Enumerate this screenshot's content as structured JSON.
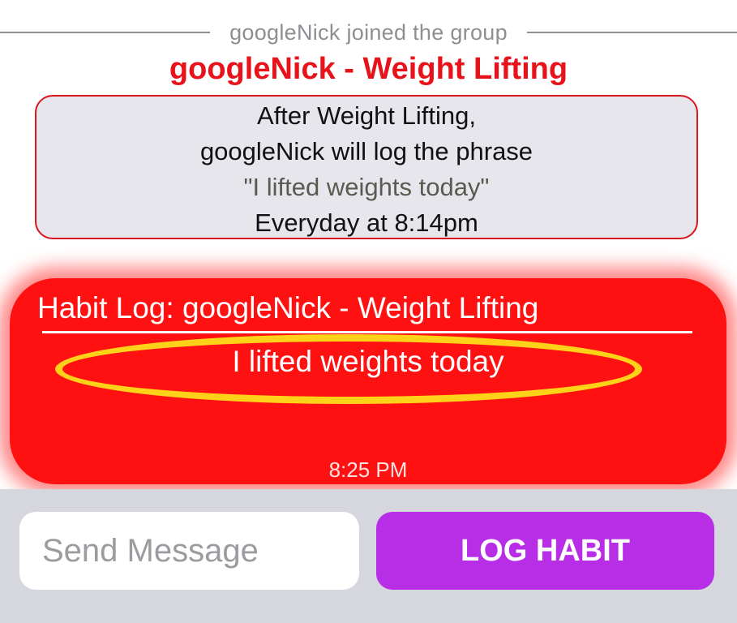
{
  "system_message": "googleNick joined the group",
  "habit": {
    "title": "googleNick - Weight Lifting",
    "line1": "After Weight Lifting,",
    "line2": "googleNick will log the phrase",
    "phrase": "\"I lifted weights today\"",
    "schedule": "Everyday at 8:14pm"
  },
  "log_entry": {
    "header": "Habit Log:  googleNick - Weight Lifting",
    "message": "I lifted weights today",
    "time": "8:25 PM"
  },
  "composer": {
    "placeholder": "Send Message",
    "button_label": "LOG HABIT"
  },
  "colors": {
    "title_red": "#e8121b",
    "bubble_red": "#ff1111",
    "button_purple": "#b72ee6",
    "highlight_yellow": "#f4dd4a"
  }
}
